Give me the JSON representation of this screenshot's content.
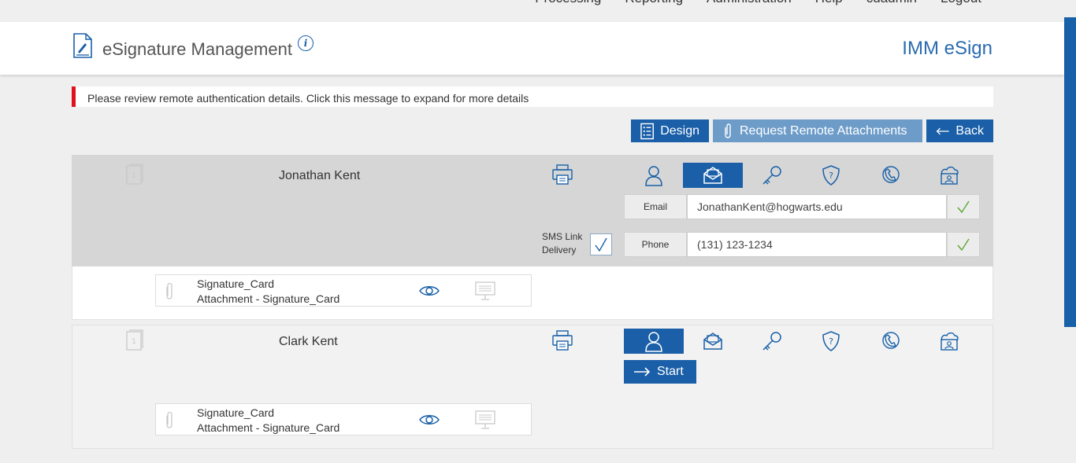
{
  "topnav": {
    "items": [
      "Processing",
      "Reporting",
      "Administration",
      "Help",
      "cuadmin",
      "Logout"
    ]
  },
  "header": {
    "title": "eSignature Management",
    "info": "i",
    "brand": "IMM eSign"
  },
  "alert": {
    "text": "Please review remote authentication details. Click this message to expand for more details",
    "color": "#e0121e"
  },
  "actions": {
    "design": "Design",
    "request": "Request Remote Attachments",
    "back": "Back"
  },
  "signers": [
    {
      "name": "Jonathan Kent",
      "book_number": "1",
      "email_label": "Email",
      "email": "JonathanKent@hogwarts.edu",
      "phone_label": "Phone",
      "phone": "(131) 123-1234",
      "sms_label_1": "SMS Link",
      "sms_label_2": "Delivery",
      "attachment": {
        "name": "Signature_Card",
        "desc": "Attachment - Signature_Card"
      },
      "active_method": "email-envelope-icon"
    },
    {
      "name": "Clark Kent",
      "book_number": "1",
      "start": "Start",
      "attachment": {
        "name": "Signature_Card",
        "desc": "Attachment - Signature_Card"
      },
      "active_method": "person-icon"
    }
  ],
  "colors": {
    "primary": "#1a5fa8",
    "accent_light": "#6d9cc9",
    "check": "#5aa830",
    "brand": "#2a6bb0"
  }
}
